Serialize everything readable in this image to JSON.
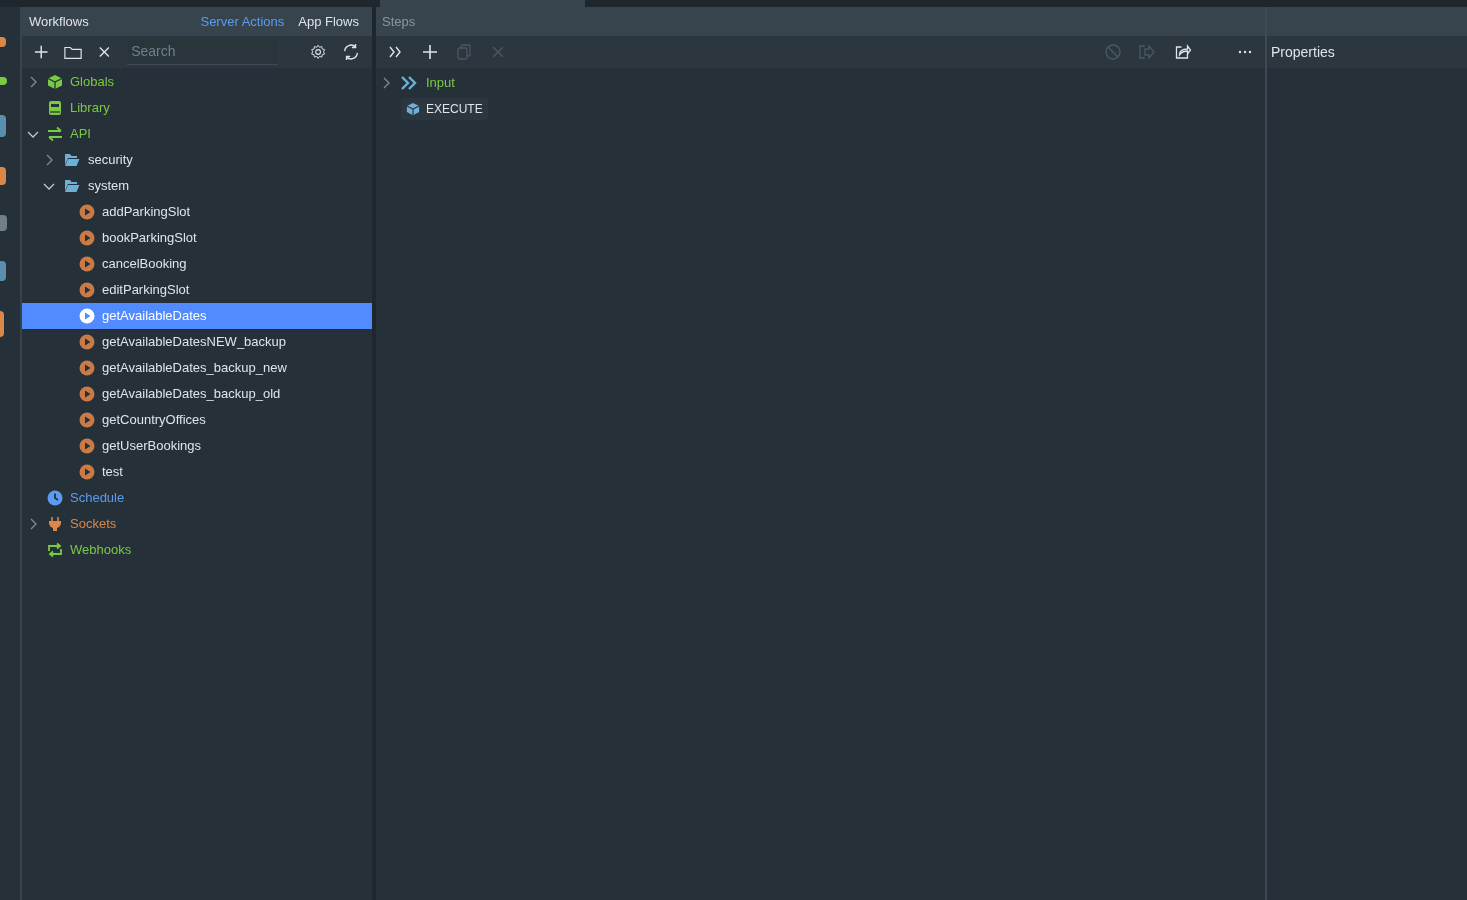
{
  "workflows_panel": {
    "title": "Workflows",
    "tabs": [
      {
        "label": "Server Actions",
        "selected": true
      },
      {
        "label": "App Flows",
        "selected": false
      }
    ],
    "search": {
      "placeholder": "Search"
    },
    "tree": [
      {
        "label": "Globals",
        "kind": "cube",
        "color": "#7ac943",
        "expanded": false,
        "selected": false
      },
      {
        "label": "Library",
        "kind": "book",
        "color": "#7ac943",
        "selected": false
      },
      {
        "label": "API",
        "kind": "swap",
        "color": "#7ac943",
        "expanded": true,
        "selected": false,
        "children": [
          {
            "label": "security",
            "kind": "folder",
            "color": "#e0e4e8",
            "expanded": false,
            "selected": false
          },
          {
            "label": "system",
            "kind": "folder",
            "color": "#e0e4e8",
            "expanded": true,
            "selected": false,
            "children": [
              {
                "label": "addParkingSlot",
                "kind": "action",
                "color": "#e0e4e8",
                "selected": false
              },
              {
                "label": "bookParkingSlot",
                "kind": "action",
                "color": "#e0e4e8",
                "selected": false
              },
              {
                "label": "cancelBooking",
                "kind": "action",
                "color": "#e0e4e8",
                "selected": false
              },
              {
                "label": "editParkingSlot",
                "kind": "action",
                "color": "#e0e4e8",
                "selected": false
              },
              {
                "label": "getAvailableDates",
                "kind": "action",
                "color": "#ffffff",
                "selected": true
              },
              {
                "label": "getAvailableDatesNEW_backup",
                "kind": "action",
                "color": "#e0e4e8",
                "selected": false
              },
              {
                "label": "getAvailableDates_backup_new",
                "kind": "action",
                "color": "#e0e4e8",
                "selected": false
              },
              {
                "label": "getAvailableDates_backup_old",
                "kind": "action",
                "color": "#e0e4e8",
                "selected": false
              },
              {
                "label": "getCountryOffices",
                "kind": "action",
                "color": "#e0e4e8",
                "selected": false
              },
              {
                "label": "getUserBookings",
                "kind": "action",
                "color": "#e0e4e8",
                "selected": false
              },
              {
                "label": "test",
                "kind": "action",
                "color": "#e0e4e8",
                "selected": false
              }
            ]
          }
        ]
      },
      {
        "label": "Schedule",
        "kind": "clock",
        "color": "#5b9bf0",
        "selected": false
      },
      {
        "label": "Sockets",
        "kind": "plug",
        "color": "#d9884a",
        "expanded": false,
        "selected": false
      },
      {
        "label": "Webhooks",
        "kind": "loop",
        "color": "#7ac943",
        "selected": false
      }
    ]
  },
  "steps_panel": {
    "title": "Steps",
    "toolbar": [
      {
        "kind": "expand",
        "disabled": false
      },
      {
        "kind": "add",
        "disabled": false
      },
      {
        "kind": "copy",
        "disabled": true
      },
      {
        "kind": "delete",
        "disabled": true
      },
      {
        "kind": "disable",
        "disabled": true
      },
      {
        "kind": "move",
        "disabled": true
      },
      {
        "kind": "share",
        "disabled": false
      },
      {
        "kind": "more",
        "disabled": false
      }
    ],
    "steps": [
      {
        "label": "Input",
        "kind": "input",
        "expanded": false
      },
      {
        "label": "EXECUTE",
        "kind": "execute"
      }
    ]
  },
  "properties_panel": {
    "title": "Properties"
  }
}
